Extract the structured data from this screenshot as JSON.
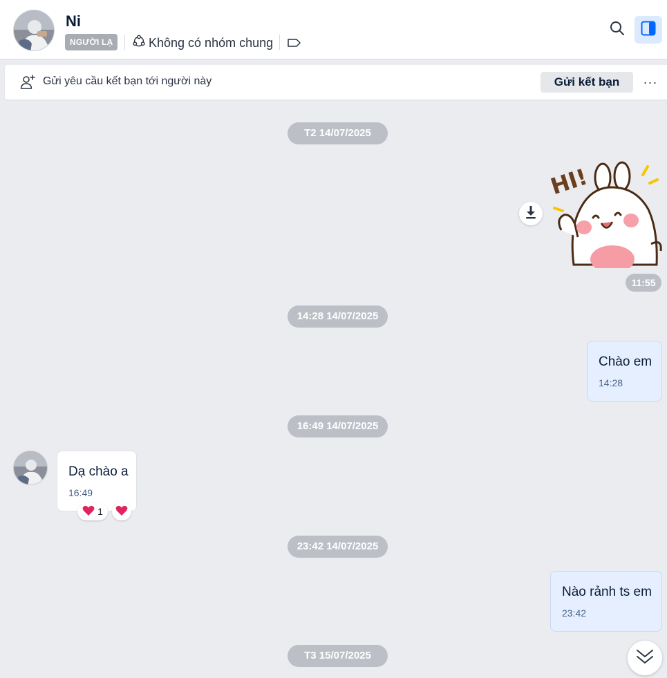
{
  "header": {
    "name": "Ni",
    "stranger_badge": "NGƯỜI LẠ",
    "mutual_groups": "Không có nhóm chung",
    "icons": [
      "avatar",
      "group-icon",
      "tag-icon",
      "search-icon",
      "side-panel-icon"
    ]
  },
  "friend_bar": {
    "text": "Gửi yêu cầu kết bạn tới người này",
    "button": "Gửi kết bạn",
    "more": "···"
  },
  "chat": {
    "date_separators": [
      "T2 14/07/2025",
      "14:28 14/07/2025",
      "16:49 14/07/2025",
      "23:42 14/07/2025",
      "T3 15/07/2025"
    ],
    "sticker": {
      "time": "11:55",
      "text": "HI!"
    },
    "messages": [
      {
        "text": "Chào em",
        "time": "14:28",
        "mine": true
      },
      {
        "text": "Dạ chào a",
        "time": "16:49",
        "mine": false,
        "reactions": {
          "count": "1"
        }
      },
      {
        "text": "Nào rảnh ts em",
        "time": "23:42",
        "mine": true
      }
    ]
  },
  "colors": {
    "accent": "#0068ff",
    "my_bubble": "#e5efff",
    "background": "#ebecf0",
    "date_pill": "#bcc0c6",
    "heart": "#e0245e"
  }
}
